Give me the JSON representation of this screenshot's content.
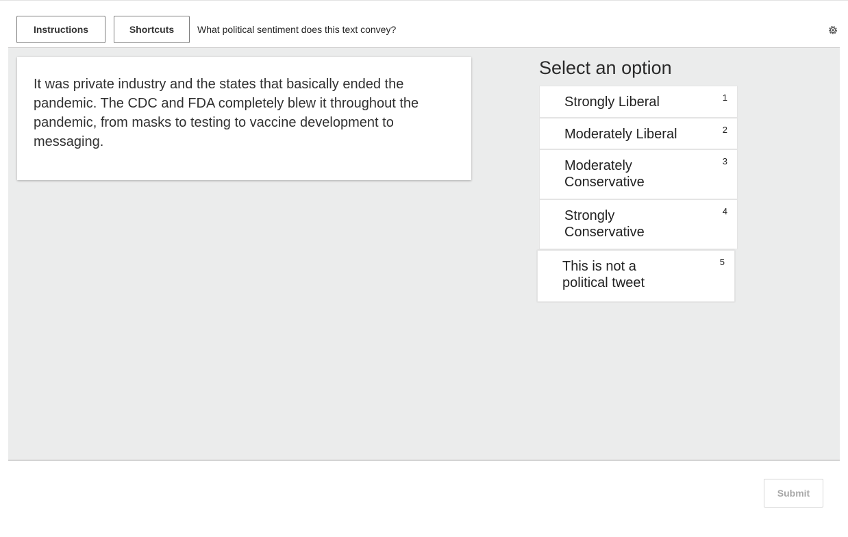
{
  "toolbar": {
    "instructions_label": "Instructions",
    "shortcuts_label": "Shortcuts",
    "question": "What political sentiment does this text convey?",
    "settings_icon": "gear-icon"
  },
  "task": {
    "text": "It was private industry and the states that basically ended the pandemic. The CDC and FDA completely blew it throughout the pandemic, from masks to testing to vaccine development to messaging."
  },
  "options_panel": {
    "title": "Select an option",
    "options": [
      {
        "label": "Strongly Liberal",
        "key": "1"
      },
      {
        "label": "Moderately Liberal",
        "key": "2"
      },
      {
        "label": "Moderately Conservative",
        "key": "3"
      },
      {
        "label": "Strongly Conservative",
        "key": "4"
      },
      {
        "label": "This is not a political tweet",
        "key": "5"
      }
    ]
  },
  "footer": {
    "submit_label": "Submit"
  },
  "colors": {
    "workarea_background": "#ebecec",
    "submit_disabled_text": "#a8a8a8"
  }
}
